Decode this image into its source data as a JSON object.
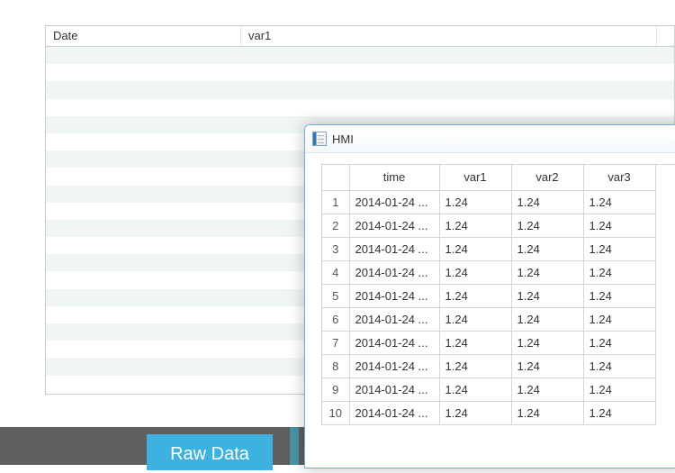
{
  "bg_table": {
    "columns": [
      "Date",
      "var1"
    ],
    "stripe_count": 20
  },
  "footer": {
    "raw_data_label": "Raw Data"
  },
  "hmi_window": {
    "title": "HMI",
    "columns": [
      "time",
      "var1",
      "var2",
      "var3"
    ],
    "rows": [
      {
        "n": 1,
        "time": "2014-01-24 ...",
        "var1": "1.24",
        "var2": "1.24",
        "var3": "1.24"
      },
      {
        "n": 2,
        "time": "2014-01-24 ...",
        "var1": "1.24",
        "var2": "1.24",
        "var3": "1.24"
      },
      {
        "n": 3,
        "time": "2014-01-24 ...",
        "var1": "1.24",
        "var2": "1.24",
        "var3": "1.24"
      },
      {
        "n": 4,
        "time": "2014-01-24 ...",
        "var1": "1.24",
        "var2": "1.24",
        "var3": "1.24"
      },
      {
        "n": 5,
        "time": "2014-01-24 ...",
        "var1": "1.24",
        "var2": "1.24",
        "var3": "1.24"
      },
      {
        "n": 6,
        "time": "2014-01-24 ...",
        "var1": "1.24",
        "var2": "1.24",
        "var3": "1.24"
      },
      {
        "n": 7,
        "time": "2014-01-24 ...",
        "var1": "1.24",
        "var2": "1.24",
        "var3": "1.24"
      },
      {
        "n": 8,
        "time": "2014-01-24 ...",
        "var1": "1.24",
        "var2": "1.24",
        "var3": "1.24"
      },
      {
        "n": 9,
        "time": "2014-01-24 ...",
        "var1": "1.24",
        "var2": "1.24",
        "var3": "1.24"
      },
      {
        "n": 10,
        "time": "2014-01-24 ...",
        "var1": "1.24",
        "var2": "1.24",
        "var3": "1.24"
      }
    ]
  }
}
